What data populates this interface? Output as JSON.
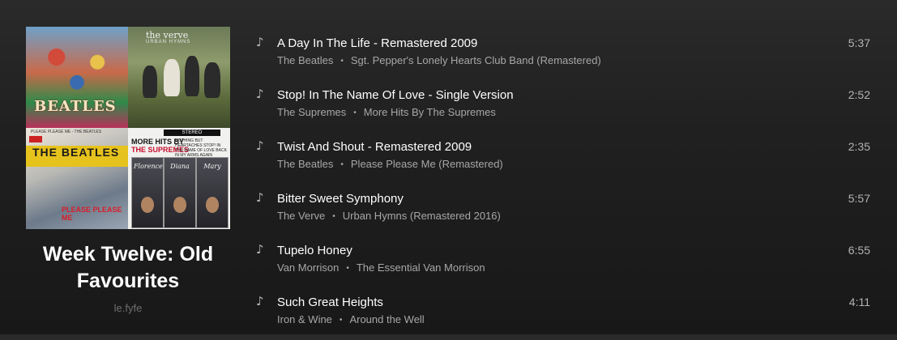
{
  "playlist": {
    "title": "Week Twelve: Old Favourites",
    "owner": "le.fyfe",
    "cover_tiles": {
      "tile1_text": "BEATLES",
      "tile2_brand": "the verve",
      "tile2_sub": "URBAN HYMNS",
      "tile3_top": "PLEASE PLEASE ME - THE BEATLES",
      "tile3_word": "THE BEATLES",
      "tile3_red": "PLEASE PLEASE ME",
      "tile4_stereo": "STEREO",
      "tile4_line1": "MORE HITS BY",
      "tile4_line2": "THE SUPREMES",
      "tile4_small": "NOTHING BUT HEARTACHES STOP! IN THE NAME OF LOVE BACK IN MY ARMS AGAIN",
      "tile4_sig1": "Florence",
      "tile4_sig2": "Diana",
      "tile4_sig3": "Mary"
    }
  },
  "tracks": [
    {
      "title": "A Day In The Life - Remastered 2009",
      "artist": "The Beatles",
      "album": "Sgt. Pepper's Lonely Hearts Club Band (Remastered)",
      "duration": "5:37"
    },
    {
      "title": "Stop! In The Name Of Love - Single Version",
      "artist": "The Supremes",
      "album": "More Hits By The Supremes",
      "duration": "2:52"
    },
    {
      "title": "Twist And Shout - Remastered 2009",
      "artist": "The Beatles",
      "album": "Please Please Me (Remastered)",
      "duration": "2:35"
    },
    {
      "title": "Bitter Sweet Symphony",
      "artist": "The Verve",
      "album": "Urban Hymns (Remastered 2016)",
      "duration": "5:57"
    },
    {
      "title": "Tupelo Honey",
      "artist": "Van Morrison",
      "album": "The Essential Van Morrison",
      "duration": "6:55"
    },
    {
      "title": "Such Great Heights",
      "artist": "Iron & Wine",
      "album": "Around the Well",
      "duration": "4:11"
    }
  ],
  "icons": {
    "track": "music-note-icon"
  },
  "colors": {
    "background": "#202020",
    "text_primary": "#ffffff",
    "text_secondary": "#a7a7a7",
    "owner": "#6e6e6e"
  }
}
